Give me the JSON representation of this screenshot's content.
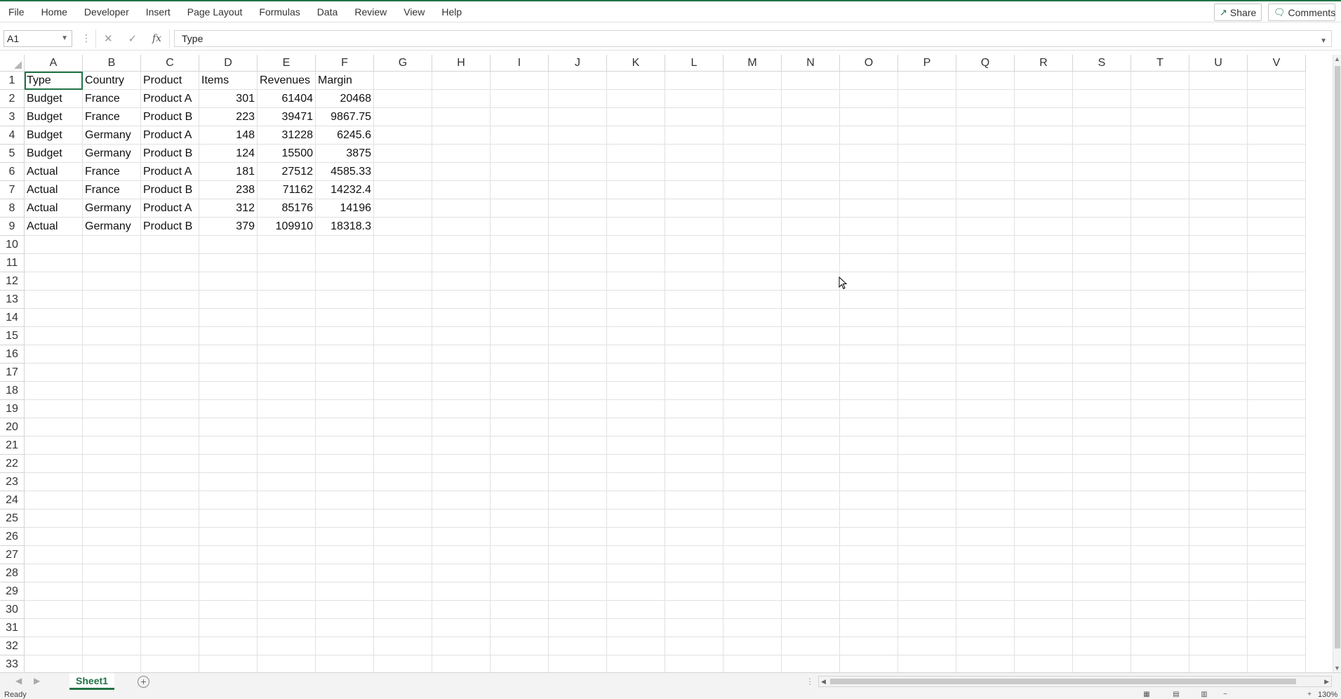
{
  "menu": [
    "File",
    "Home",
    "Developer",
    "Insert",
    "Page Layout",
    "Formulas",
    "Data",
    "Review",
    "View",
    "Help"
  ],
  "share_label": "Share",
  "comments_label": "Comments",
  "name_box": "A1",
  "formula_value": "Type",
  "columns": [
    "A",
    "B",
    "C",
    "D",
    "E",
    "F",
    "G",
    "H",
    "I",
    "J",
    "K",
    "L",
    "M",
    "N",
    "O",
    "P",
    "Q",
    "R",
    "S",
    "T",
    "U",
    "V"
  ],
  "row_count": 33,
  "header_row": [
    "Type",
    "Country",
    "Product",
    "Items",
    "Revenues",
    "Margin"
  ],
  "rows": [
    [
      "Budget",
      "France",
      "Product A",
      "301",
      "61404",
      "20468"
    ],
    [
      "Budget",
      "France",
      "Product B",
      "223",
      "39471",
      "9867.75"
    ],
    [
      "Budget",
      "Germany",
      "Product A",
      "148",
      "31228",
      "6245.6"
    ],
    [
      "Budget",
      "Germany",
      "Product B",
      "124",
      "15500",
      "3875"
    ],
    [
      "Actual",
      "France",
      "Product A",
      "181",
      "27512",
      "4585.33"
    ],
    [
      "Actual",
      "France",
      "Product B",
      "238",
      "71162",
      "14232.4"
    ],
    [
      "Actual",
      "Germany",
      "Product A",
      "312",
      "85176",
      "14196"
    ],
    [
      "Actual",
      "Germany",
      "Product B",
      "379",
      "109910",
      "18318.3"
    ]
  ],
  "sheet_tab": "Sheet1",
  "status_text": "Ready",
  "zoom_text": "130%",
  "accent_color": "#217346"
}
